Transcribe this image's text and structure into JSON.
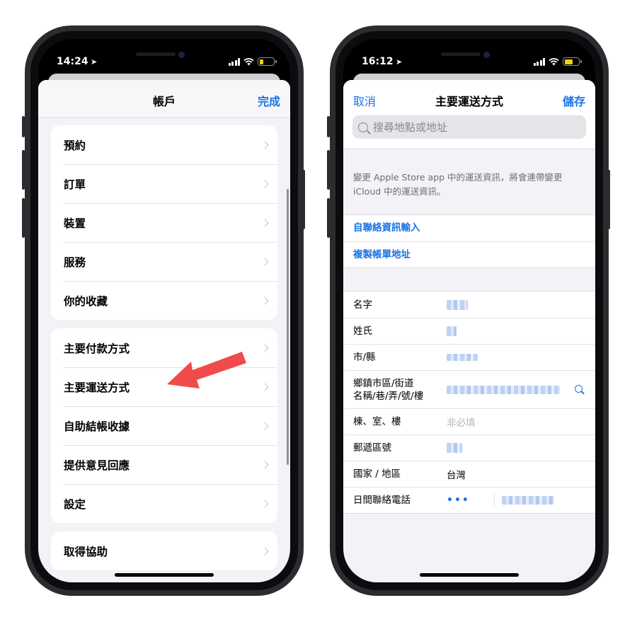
{
  "left_phone": {
    "status": {
      "time": "14:24",
      "location_glyph": "➤",
      "battery_color": "#f4d210"
    },
    "nav": {
      "title": "帳戶",
      "done_label": "完成"
    },
    "groups": [
      {
        "items": [
          "預約",
          "訂單",
          "裝置",
          "服務",
          "你的收藏"
        ]
      },
      {
        "items": [
          "主要付款方式",
          "主要運送方式",
          "自助結帳收據",
          "提供意見回應",
          "設定"
        ]
      },
      {
        "items": [
          "取得協助"
        ]
      }
    ],
    "arrow_color": "#ef4b4b"
  },
  "right_phone": {
    "status": {
      "time": "16:12",
      "location_glyph": "➤",
      "battery_color": "#f4d210"
    },
    "nav": {
      "cancel_label": "取消",
      "title": "主要運送方式",
      "save_label": "儲存"
    },
    "search": {
      "placeholder": "搜尋地點或地址"
    },
    "description": "變更 Apple Store app 中的運送資訊，將會連帶變更 iCloud 中的運送資訊。",
    "links": [
      "自聯絡資訊輸入",
      "複製帳單地址"
    ],
    "form": {
      "first_name_label": "名字",
      "last_name_label": "姓氏",
      "city_label": "市/縣",
      "street_label_line1": "鄉鎮市區/街道",
      "street_label_line2": "名稱/巷/弄/號/樓",
      "building_label": "棟、室、樓",
      "building_placeholder": "非必填",
      "postal_label": "郵遞區號",
      "country_label": "國家 / 地區",
      "country_value": "台灣",
      "phone_label": "日間聯絡電話",
      "phone_code": "•••"
    },
    "accent_color": "#1a73e8"
  }
}
